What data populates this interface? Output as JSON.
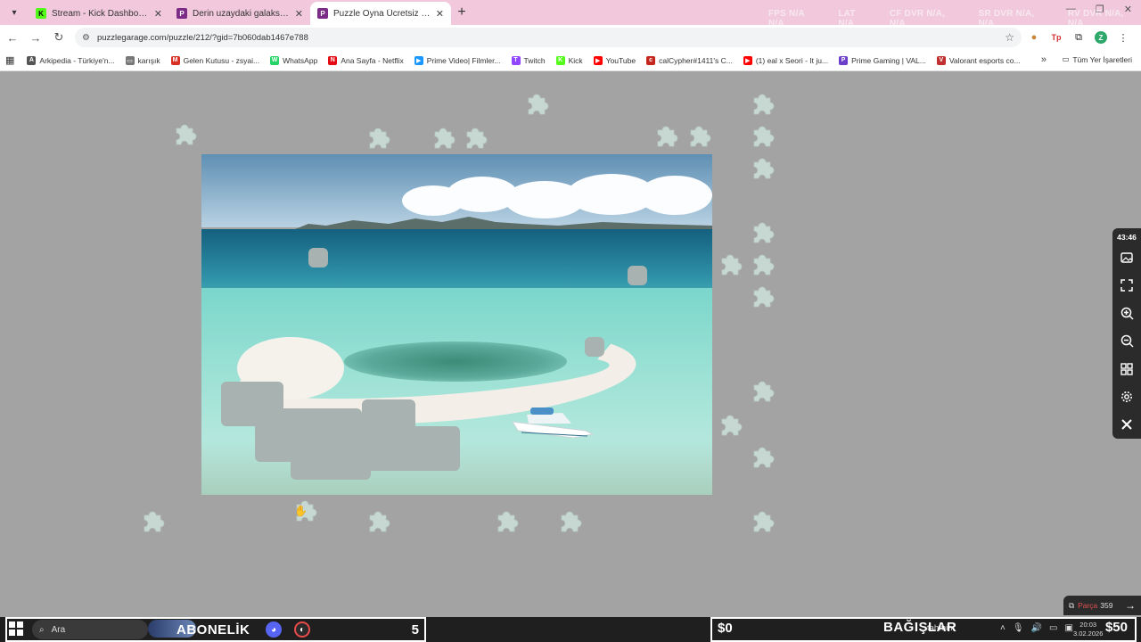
{
  "browser": {
    "tabs": [
      {
        "title": "Stream - Kick Dashboard",
        "icon": "kick-icon",
        "color": "#53fc18",
        "letter": "K",
        "active": false
      },
      {
        "title": "Derin uzaydaki galaksiler Puzzle",
        "icon": "puzzle-site-icon",
        "color": "#7a2c86",
        "letter": "P",
        "active": false
      },
      {
        "title": "Puzzle Oyna Ücretsiz – Yetişkin",
        "icon": "puzzle-site-icon",
        "color": "#7a2c86",
        "letter": "P",
        "active": true
      }
    ],
    "overlay_stats": [
      "FPS N/A N/A",
      "LAT N/A",
      "CF DVR N/A, N/A",
      "SR DVR N/A, N/A",
      "RV DVR N/A, N/A"
    ],
    "url": "puzzlegarage.com/puzzle/212/?gid=7b060dab1467e788",
    "profile_letter": "Z",
    "bookmarks": [
      {
        "label": "Arkipedia - Türkiye'n...",
        "color": "#555555",
        "letter": "A"
      },
      {
        "label": "karışık",
        "color": "#777777",
        "letter": "▭"
      },
      {
        "label": "Gelen Kutusu - zsyai...",
        "color": "#d93025",
        "letter": "M"
      },
      {
        "label": "WhatsApp",
        "color": "#25d366",
        "letter": "W"
      },
      {
        "label": "Ana Sayfa - Netflix",
        "color": "#e50914",
        "letter": "N"
      },
      {
        "label": "Prime Video| Filmler...",
        "color": "#1a98ff",
        "letter": "▶"
      },
      {
        "label": "Twitch",
        "color": "#9146ff",
        "letter": "T"
      },
      {
        "label": "Kick",
        "color": "#53fc18",
        "letter": "K"
      },
      {
        "label": "YouTube",
        "color": "#ff0000",
        "letter": "▶"
      },
      {
        "label": "calCypher#1411's C...",
        "color": "#c4261d",
        "letter": "c"
      },
      {
        "label": "(1) eal x Seori - It ju...",
        "color": "#ff0000",
        "letter": "▶"
      },
      {
        "label": "Prime Gaming | VAL...",
        "color": "#6b3fc9",
        "letter": "P"
      },
      {
        "label": "Valorant esports co...",
        "color": "#c03030",
        "letter": "V"
      }
    ],
    "all_bookmarks": "Tüm Yer İşaretleri"
  },
  "puzzle": {
    "timer": "43:46",
    "pieces_label": "Parça",
    "pieces_count": "359"
  },
  "taskbar": {
    "search_placeholder": "Ara",
    "abonelik_label": "ABONELİK",
    "abonelik_count": "5",
    "bagis_left": "$0",
    "bagis_label": "BAĞIŞLAR",
    "bagis_right": "$50",
    "weather": "tahmini",
    "time": "20:03",
    "date": "3.02.2026"
  },
  "colors": {
    "tab_strip": "#f2c9dc",
    "canvas": "#a3a3a3",
    "piece": "#c7d8d3"
  }
}
